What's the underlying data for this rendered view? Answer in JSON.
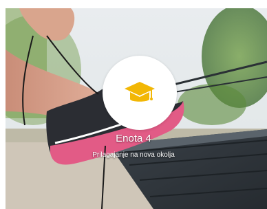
{
  "card": {
    "unit_title": "Enota 4",
    "unit_subtitle": "Prilagajanje na nova okolja",
    "badge_icon": "graduation-cap-icon",
    "accent_color": "#F2B705",
    "background_image": "photo of a runner tying a pink-and-black sneaker on a park bench"
  }
}
